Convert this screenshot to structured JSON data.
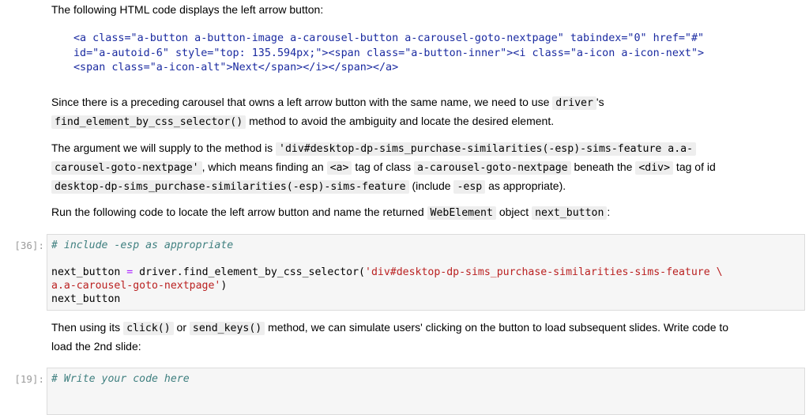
{
  "intro": "The following HTML code displays the left arrow button:",
  "html_snippet": {
    "line1": "<a class=\"a-button a-button-image a-carousel-button a-carousel-goto-nextpage\" tabindex=\"0\" href=\"#\"",
    "line2": "id=\"a-autoid-6\" style=\"top: 135.594px;\"><span class=\"a-button-inner\"><i class=\"a-icon a-icon-next\">",
    "line3": "<span class=\"a-icon-alt\">Next</span></i></span></a>"
  },
  "para1": {
    "t1": "Since there is a preceding carousel that owns a left arrow button with the same name, we need to use ",
    "c1": "driver",
    "t2": "'s",
    "c2": "find_element_by_css_selector()",
    "t3": " method to avoid the ambiguity and locate the desired element."
  },
  "para2": {
    "t1": "The argument we will supply to the method is ",
    "c1a": "'div#desktop-dp-sims_purchase-similarities(-esp)-sims-feature a.a-",
    "c1b": "carousel-goto-nextpage'",
    "t2": ", which means finding an ",
    "c2": "<a>",
    "t3": " tag of class ",
    "c3": "a-carousel-goto-nextpage",
    "t4": " beneath the ",
    "c4": "<div>",
    "t5": " tag of id",
    "c5": "desktop-dp-sims_purchase-similarities(-esp)-sims-feature",
    "t6": " (include ",
    "c6": "-esp",
    "t7": " as appropriate)."
  },
  "para3": {
    "t1": "Run the following code to locate the left arrow button and name the returned ",
    "c1": "WebElement",
    "t2": " object ",
    "c2": "next_button",
    "t3": ":"
  },
  "cell1": {
    "prompt": "[36]:",
    "comment": "# include -esp as appropriate",
    "l2_var": "next_button",
    "l2_eq": " = ",
    "l2_call": "driver.find_element_by_css_selector(",
    "l2_str": "'div#desktop-dp-sims_purchase-similarities-sims-feature \\",
    "l3_str": "a.a-carousel-goto-nextpage'",
    "l3_close": ")",
    "l4": "next_button"
  },
  "para4": {
    "t1": "Then using its ",
    "c1": "click()",
    "t2": " or ",
    "c2": "send_keys()",
    "t3": " method, we can simulate users' clicking on the button to load subsequent slides. Write code to",
    "t4": "load the 2nd slide:"
  },
  "cell2": {
    "prompt": "[19]:",
    "comment": "# Write your code here"
  }
}
